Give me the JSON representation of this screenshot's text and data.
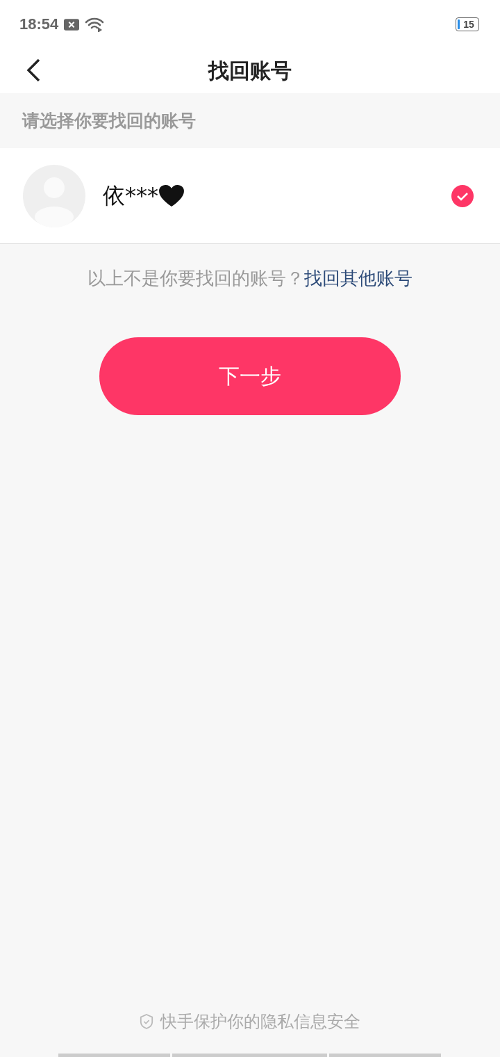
{
  "status_bar": {
    "time": "18:54",
    "battery": "15"
  },
  "header": {
    "title": "找回账号"
  },
  "section_label": "请选择你要找回的账号",
  "accounts": [
    {
      "name": "依***",
      "selected": true
    }
  ],
  "other_prompt": {
    "text": "以上不是你要找回的账号？",
    "link": "找回其他账号"
  },
  "next_button": "下一步",
  "footer": "快手保护你的隐私信息安全"
}
